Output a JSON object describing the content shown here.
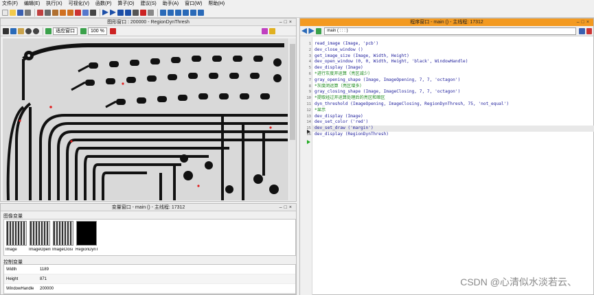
{
  "menu": [
    "文件(F)",
    "编辑(E)",
    "执行(X)",
    "可视化(V)",
    "函数(P)",
    "算子(O)",
    "建议(S)",
    "助手(A)",
    "窗口(W)",
    "帮助(H)"
  ],
  "graphics_window": {
    "title": "图形窗口 : 200000 - RegionDynThresh",
    "fit_label": "适应窗口",
    "zoom_label": "100 %"
  },
  "variable_window": {
    "title": "变量窗口 - main () - 主线程: 17312",
    "image_section": "图像变量",
    "images": [
      {
        "name": "Image",
        "dark": false
      },
      {
        "name": "ImageOpeni",
        "dark": false
      },
      {
        "name": "ImageClosi",
        "dark": false
      },
      {
        "name": "RegionDynT",
        "dark": true
      }
    ],
    "control_section": "控制变量",
    "controls": [
      {
        "name": "Width",
        "value": "1189"
      },
      {
        "name": "Height",
        "value": "871"
      },
      {
        "name": "WindowHandle",
        "value": "200000"
      }
    ]
  },
  "program_window": {
    "title": "程序窗口 - main () - 主线程: 17312",
    "procedure": "main ( : : : )",
    "lines": [
      {
        "n": "1",
        "text": "read_image (Image, 'pcb')",
        "comment": false
      },
      {
        "n": "2",
        "text": "dev_close_window ()",
        "comment": false
      },
      {
        "n": "3",
        "text": "get_image_size (Image, Width, Height)",
        "comment": false
      },
      {
        "n": "4",
        "text": "dev_open_window (0, 0, Width, Height, 'black', WindowHandle)",
        "comment": false
      },
      {
        "n": "5",
        "text": "dev_display (Image)",
        "comment": false
      },
      {
        "n": "6",
        "text": "*进行灰度开运算（亮区减少）",
        "comment": true
      },
      {
        "n": "7",
        "text": "gray_opening_shape (Image, ImageOpening, 7, 7, 'octagon')",
        "comment": false
      },
      {
        "n": "8",
        "text": "*灰度闭运算（亮区增多）",
        "comment": true
      },
      {
        "n": "9",
        "text": "gray_closing_shape (Image, ImageClosing, 7, 7, 'octagon')",
        "comment": false
      },
      {
        "n": "10",
        "text": "*提取经过开运算处理后的亮区和暗区",
        "comment": true
      },
      {
        "n": "11",
        "text": "dyn_threshold (ImageOpening, ImageClosing, RegionDynThresh, 75, 'not_equal')",
        "comment": false
      },
      {
        "n": "12",
        "text": "*显示",
        "comment": true
      },
      {
        "n": "13",
        "text": "dev_display (Image)",
        "comment": false
      },
      {
        "n": "14",
        "text": "dev_set_color ('red')",
        "comment": false
      },
      {
        "n": "15",
        "text": "dev_set_draw ('margin')",
        "comment": false
      },
      {
        "n": "16",
        "text": "dev_display (RegionDynThresh)",
        "comment": false
      }
    ]
  },
  "watermark": "CSDN @心清似水淡若云、",
  "colors": {
    "program_title": "#f39a21",
    "code": "#1a1a9a",
    "comment": "#1a8a1a"
  }
}
